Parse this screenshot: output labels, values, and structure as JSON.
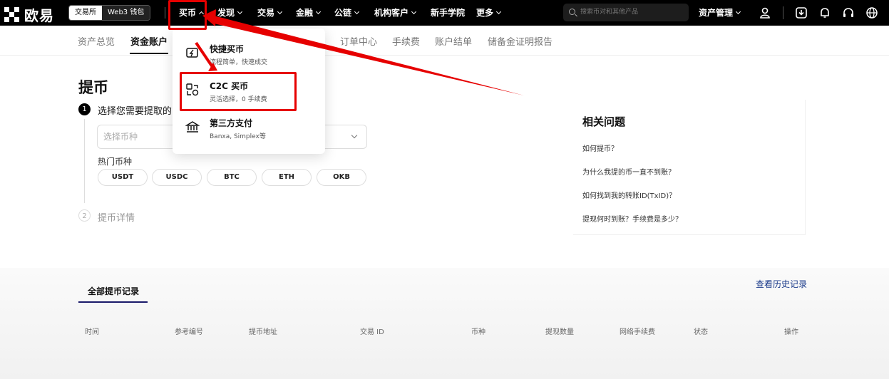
{
  "brand": {
    "name": "欧易"
  },
  "mode_switch": {
    "exchange": "交易所",
    "web3": "Web3 钱包"
  },
  "topnav": {
    "items": [
      "买币",
      "发现",
      "交易",
      "金融",
      "公链",
      "机构客户",
      "新手学院",
      "更多"
    ],
    "search_placeholder": "搜索币对和其他产品",
    "asset_management": "资产管理"
  },
  "subnav": {
    "items": [
      "资产总览",
      "资金账户",
      "订单中心",
      "手续费",
      "账户结单",
      "储备金证明报告"
    ],
    "active": "资金账户"
  },
  "dropdown": {
    "items": [
      {
        "title": "快捷买币",
        "sub": "流程简单，快速成交",
        "icon": "lightning-card-icon"
      },
      {
        "title": "C2C 买币",
        "sub": "灵活选择，0 手续费",
        "icon": "c2c-exchange-icon"
      },
      {
        "title": "第三方支付",
        "sub": "Banxa, Simplex等",
        "icon": "bank-icon"
      }
    ]
  },
  "withdraw": {
    "title": "提币",
    "step1": "选择您需要提取的",
    "step1_num": "1",
    "coin_placeholder": "选择币种",
    "hot_label": "热门币种",
    "hot_coins": [
      "USDT",
      "USDC",
      "BTC",
      "ETH",
      "OKB"
    ],
    "step2": "提币详情",
    "step2_num": "2"
  },
  "faq": {
    "title": "相关问题",
    "links": [
      "如何提币？",
      "为什么我提的币一直不到账？",
      "如何找到我的转账ID(TxID)？",
      "提现何时到账？手续费是多少？"
    ]
  },
  "history": {
    "tab": "全部提币记录",
    "view_history": "查看历史记录",
    "columns": [
      "时间",
      "参考编号",
      "提币地址",
      "交易 ID",
      "币种",
      "提现数量",
      "网络手续费",
      "状态",
      "操作"
    ]
  },
  "annotation_color": "#e60000"
}
